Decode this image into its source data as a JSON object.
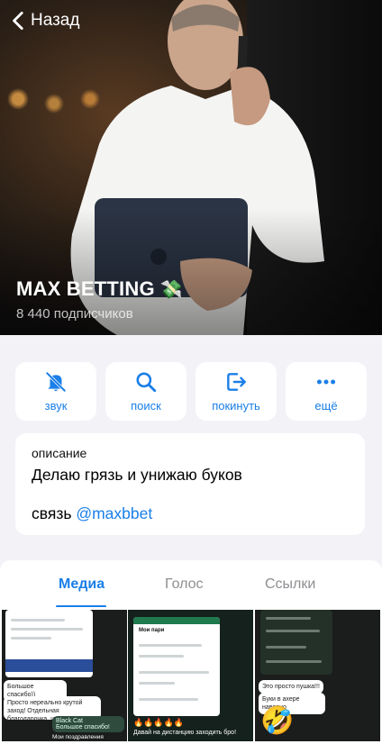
{
  "header": {
    "back_label": "Назад"
  },
  "channel": {
    "name": "MAX BETTING",
    "name_emoji": "💸",
    "subscribers": "8 440 подписчиков"
  },
  "actions": [
    {
      "label": "звук",
      "icon": "bell-slash-icon"
    },
    {
      "label": "поиск",
      "icon": "search-icon"
    },
    {
      "label": "покинуть",
      "icon": "leave-icon"
    },
    {
      "label": "ещё",
      "icon": "more-icon"
    }
  ],
  "description": {
    "label": "описание",
    "text": "Делаю грязь и унижаю буков",
    "contact_prefix": "связь",
    "contact_link": "@maxbbet"
  },
  "tabs": [
    {
      "label": "Медиа",
      "active": true
    },
    {
      "label": "Голос",
      "active": false
    },
    {
      "label": "Ссылки",
      "active": false
    }
  ],
  "media": [
    {
      "texts": [
        "Большое спасибо))",
        "Просто нереально крутой заход! Отдельная благодарочка, что уговорил взять",
        "Black Cat",
        "Большое спасибо!",
        "Мои поздравления"
      ]
    },
    {
      "texts": [
        "Мои пари",
        "Давай на дистанцию заходить бро!"
      ]
    },
    {
      "texts": [
        "Это просто пушка!!!",
        "Буки в ахере наверно"
      ]
    }
  ],
  "colors": {
    "accent": "#1a7fe8",
    "background": "#f2f2f7"
  }
}
